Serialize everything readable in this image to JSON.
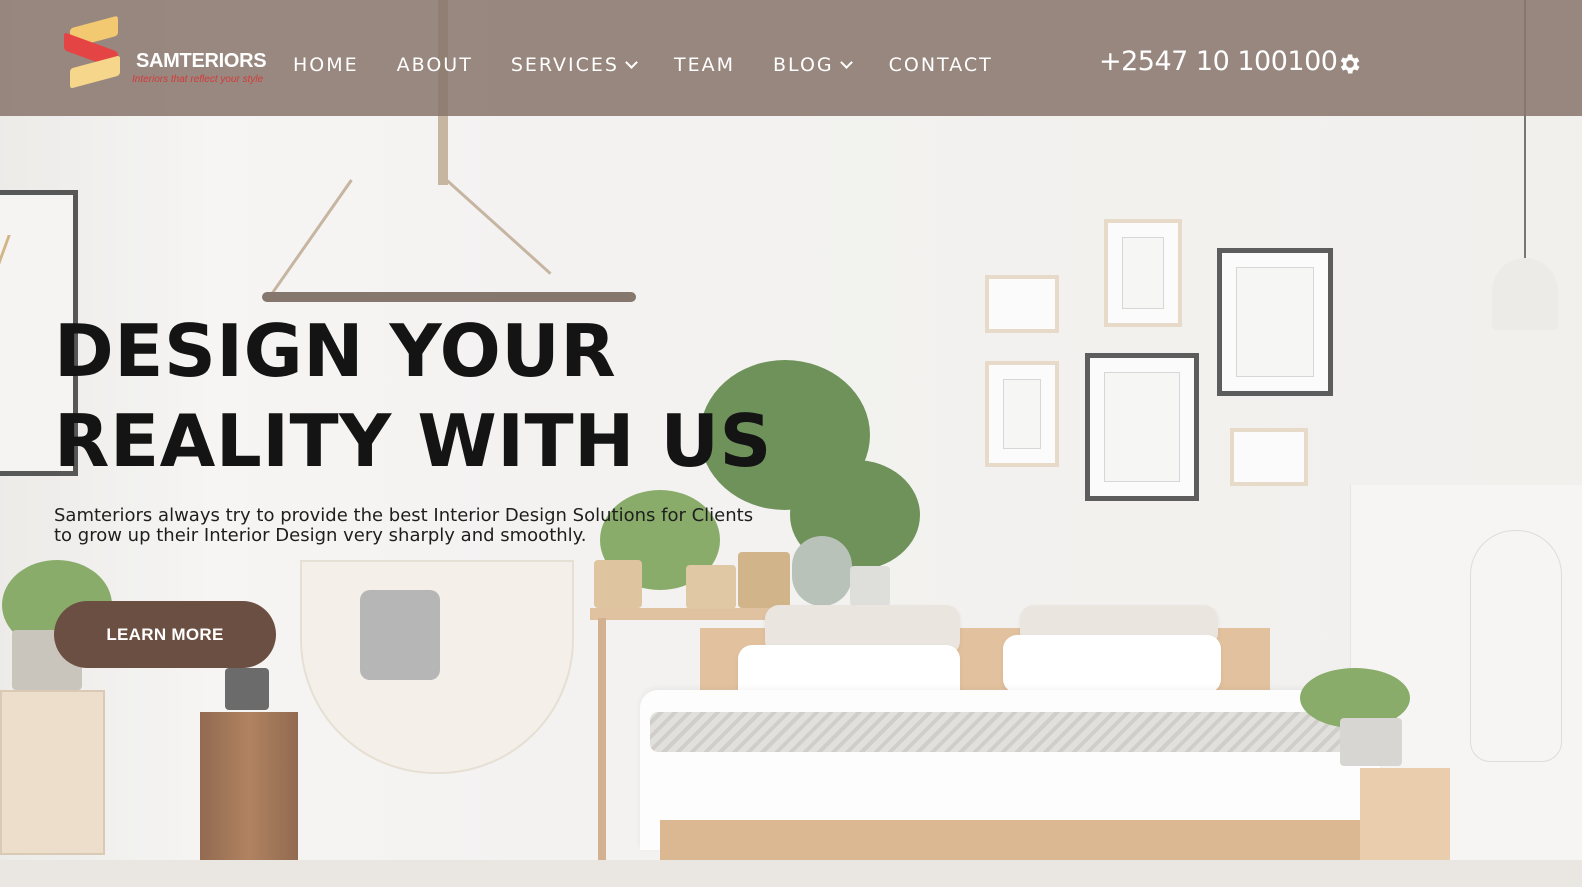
{
  "brand": {
    "name": "SAMTERIORS",
    "tagline": "Interiors that reflect your style"
  },
  "nav": {
    "items": [
      {
        "label": "HOME",
        "dropdown": false
      },
      {
        "label": "ABOUT",
        "dropdown": false
      },
      {
        "label": "SERVICES",
        "dropdown": true
      },
      {
        "label": "TEAM",
        "dropdown": false
      },
      {
        "label": "BLOG",
        "dropdown": true
      },
      {
        "label": "CONTACT",
        "dropdown": false
      }
    ]
  },
  "header": {
    "phone": "+2547 10 100100",
    "settings_icon": "gear-icon"
  },
  "hero": {
    "headline_line1": "DESIGN YOUR",
    "headline_line2": "REALITY WITH US",
    "subtitle": "Samteriors always try to provide the best Interior Design Solutions for Clients to grow up their Interior Design very sharply and smoothly.",
    "cta_label": "LEARN MORE"
  },
  "colors": {
    "header_bg": "#88766c",
    "cta_bg": "#6b4f43",
    "headline": "#141414",
    "logo_red": "#e54444",
    "logo_gold": "#f2c870"
  }
}
